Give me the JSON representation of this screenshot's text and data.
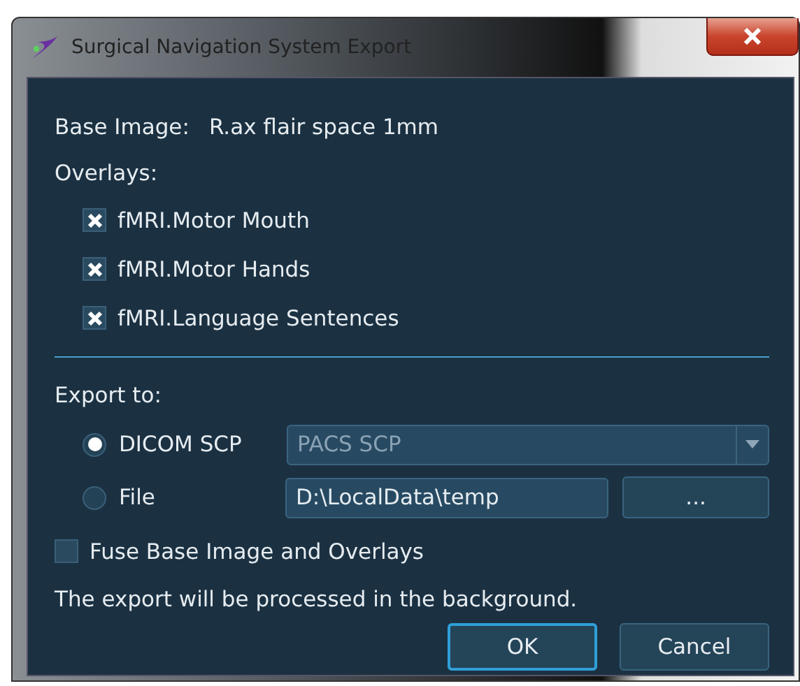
{
  "window": {
    "title": "Surgical Navigation System Export"
  },
  "base_image": {
    "label": "Base Image:",
    "value": "R.ax flair space 1mm"
  },
  "overlays": {
    "label": "Overlays:",
    "items": [
      {
        "label": "fMRI.Motor Mouth",
        "checked": true
      },
      {
        "label": "fMRI.Motor Hands",
        "checked": true
      },
      {
        "label": "fMRI.Language Sentences",
        "checked": true
      }
    ]
  },
  "export_to": {
    "label": "Export to:",
    "options": [
      {
        "kind": "dropdown",
        "label": "DICOM SCP",
        "selected": true,
        "value": "PACS SCP"
      },
      {
        "kind": "path",
        "label": "File",
        "selected": false,
        "value": "D:\\LocalData\\temp",
        "button": "..."
      }
    ]
  },
  "fuse": {
    "label": "Fuse Base Image and Overlays",
    "checked": false
  },
  "message": "The export will be processed in the background.",
  "buttons": [
    {
      "label": "OK",
      "default": true
    },
    {
      "label": "Cancel",
      "default": false
    }
  ]
}
